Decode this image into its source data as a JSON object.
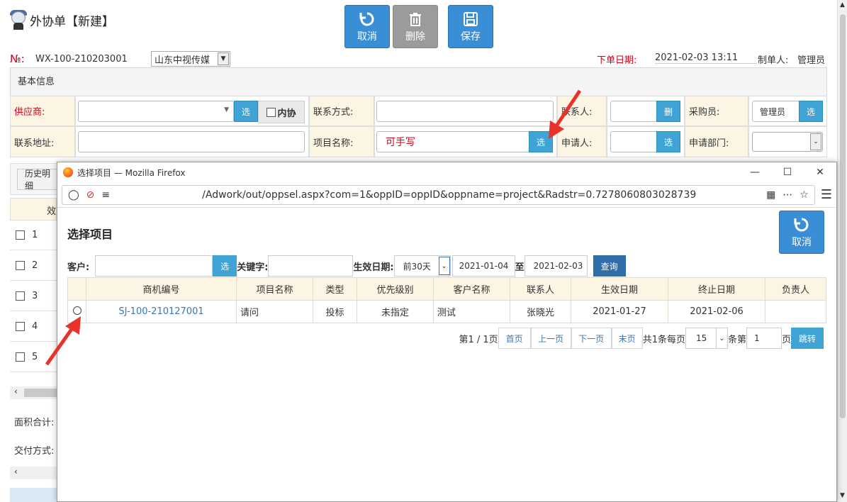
{
  "page": {
    "title": "外协单【新建】"
  },
  "toolbar": {
    "cancel": "取消",
    "delete": "删除",
    "save": "保存"
  },
  "header": {
    "no_label": "№:",
    "no_value": "WX-100-210203001",
    "company": "山东中视传媒",
    "order_date_label": "下单日期:",
    "order_date": "2021-02-03 13:11",
    "creator_label": "制单人:",
    "creator": "管理员"
  },
  "basic": {
    "title": "基本信息",
    "supplier_label": "供应商:",
    "select": "选",
    "internal": "内协",
    "contact_method_label": "联系方式:",
    "contact_person_label": "联系人:",
    "delete_short": "删",
    "buyer_label": "采购员:",
    "buyer_value": "管理员",
    "address_label": "联系地址:",
    "project_label": "项目名称:",
    "project_value": "可手写",
    "applicant_label": "申请人:",
    "dept_label": "申请部门:"
  },
  "left": {
    "history": "历史明细",
    "col": "效",
    "rows": [
      "1",
      "2",
      "3",
      "4",
      "5"
    ],
    "area_total": "面积合计:",
    "delivery": "交付方式:"
  },
  "popup": {
    "window_title": "选择项目 — Mozilla Firefox",
    "url": "/Adwork/out/oppsel.aspx?com=1&oppID=oppID&oppname=project&Radstr=0.7278060803028739",
    "heading": "选择项目",
    "cancel": "取消",
    "filter": {
      "customer_label": "客户:",
      "select": "选",
      "keyword_label": "关键字:",
      "date_label": "生效日期:",
      "range": "前30天",
      "from": "2021-01-04",
      "to_label": "至",
      "to": "2021-02-03",
      "query": "查询"
    },
    "columns": [
      "商机编号",
      "项目名称",
      "类型",
      "优先级别",
      "客户名称",
      "联系人",
      "生效日期",
      "终止日期",
      "负责人"
    ],
    "rows": [
      [
        "SJ-100-210127001",
        "请问",
        "投标",
        "未指定",
        "测试",
        "张晓光",
        "2021-01-27",
        "2021-02-06",
        ""
      ]
    ],
    "pager": {
      "page_info": "第1 / 1页",
      "first": "首页",
      "prev": "上一页",
      "next": "下一页",
      "last": "末页",
      "total": "共1条每页",
      "page_size": "15",
      "goto_prefix": "条第",
      "goto_value": "1",
      "goto_suffix": "页",
      "jump": "跳转"
    }
  },
  "colors": {
    "accent": "#3a8ed6",
    "label_bg": "#fcf5e4",
    "required": "#d0021b",
    "arrow": "#e8322a"
  }
}
